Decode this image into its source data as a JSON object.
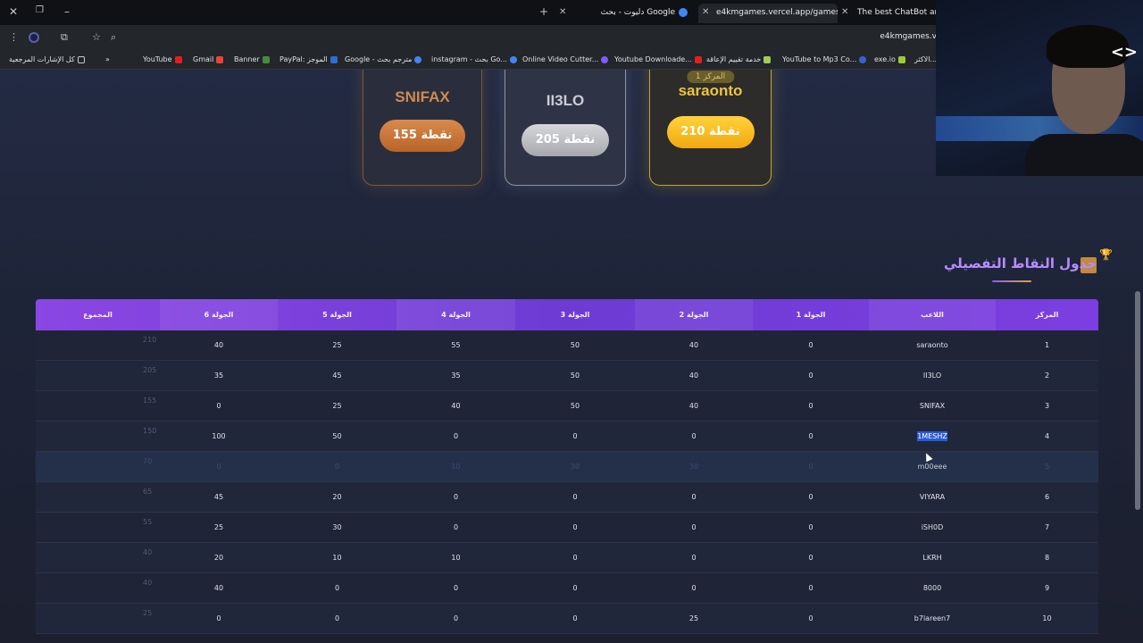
{
  "browser": {
    "tabs": [
      {
        "label": "دليوت - بحث Google"
      },
      {
        "label": "e4kmgames.vercel.app/games/"
      },
      {
        "label": "The best ChatBot and Wi"
      }
    ],
    "url": "e4kmgames.v",
    "bookmarks": [
      "كل الإشارات المرجعية",
      "YouTube",
      "Gmail",
      "Banner",
      "PayPal: الموجز",
      "Google - مترجم بحث",
      "instagram - بحث Go...",
      "Online Video Cutter...",
      "Youtube Downloade...",
      "خدمة تقييم الإعاقة",
      "YouTube to Mp3 Co...",
      "exe.io",
      "الاكثر..."
    ]
  },
  "podium": {
    "third": {
      "name": "SNIFAX",
      "points": "155 نقطة"
    },
    "second": {
      "name": "II3LO",
      "points": "205 نقطة"
    },
    "first": {
      "rank": "المركز 1",
      "name": "saraonto",
      "points": "210 نقطة"
    }
  },
  "section": {
    "title": "جدول النقاط التفصيلي"
  },
  "table": {
    "headers": {
      "rank": "المركز",
      "player": "اللاعب",
      "r1": "الجولة 1",
      "r2": "الجولة 2",
      "r3": "الجولة 3",
      "r4": "الجولة 4",
      "r5": "الجولة 5",
      "r6": "الجولة 6",
      "total": "المجموع"
    },
    "rows": [
      {
        "rank": "1",
        "player": "saraonto",
        "r1": "0",
        "r2": "40",
        "r3": "50",
        "r4": "55",
        "r5": "25",
        "r6": "40",
        "total": "210"
      },
      {
        "rank": "2",
        "player": "II3LO",
        "r1": "0",
        "r2": "40",
        "r3": "50",
        "r4": "35",
        "r5": "45",
        "r6": "35",
        "total": "205"
      },
      {
        "rank": "3",
        "player": "SNIFAX",
        "r1": "0",
        "r2": "40",
        "r3": "50",
        "r4": "40",
        "r5": "25",
        "r6": "0",
        "total": "155"
      },
      {
        "rank": "4",
        "player": "1MESHZ",
        "r1": "0",
        "r2": "0",
        "r3": "0",
        "r4": "0",
        "r5": "50",
        "r6": "100",
        "total": "150"
      },
      {
        "rank": "5",
        "player": "m00eee",
        "r1": "0",
        "r2": "30",
        "r3": "30",
        "r4": "10",
        "r5": "0",
        "r6": "0",
        "total": "70"
      },
      {
        "rank": "6",
        "player": "VIYARA",
        "r1": "0",
        "r2": "0",
        "r3": "0",
        "r4": "0",
        "r5": "20",
        "r6": "45",
        "total": "65"
      },
      {
        "rank": "7",
        "player": "iSH0D",
        "r1": "0",
        "r2": "0",
        "r3": "0",
        "r4": "0",
        "r5": "30",
        "r6": "25",
        "total": "55"
      },
      {
        "rank": "8",
        "player": "LKRH",
        "r1": "0",
        "r2": "0",
        "r3": "0",
        "r4": "10",
        "r5": "10",
        "r6": "20",
        "total": "40"
      },
      {
        "rank": "9",
        "player": "8000",
        "r1": "0",
        "r2": "0",
        "r3": "0",
        "r4": "0",
        "r5": "0",
        "r6": "40",
        "total": "40"
      },
      {
        "rank": "10",
        "player": "b7lareen7",
        "r1": "0",
        "r2": "25",
        "r3": "0",
        "r4": "0",
        "r5": "0",
        "r6": "0",
        "total": "25"
      }
    ]
  },
  "colors": {
    "accent": "#8b46e4",
    "gold": "#f2b31c",
    "silver": "#c9ccd4",
    "bronze": "#c97a42"
  }
}
